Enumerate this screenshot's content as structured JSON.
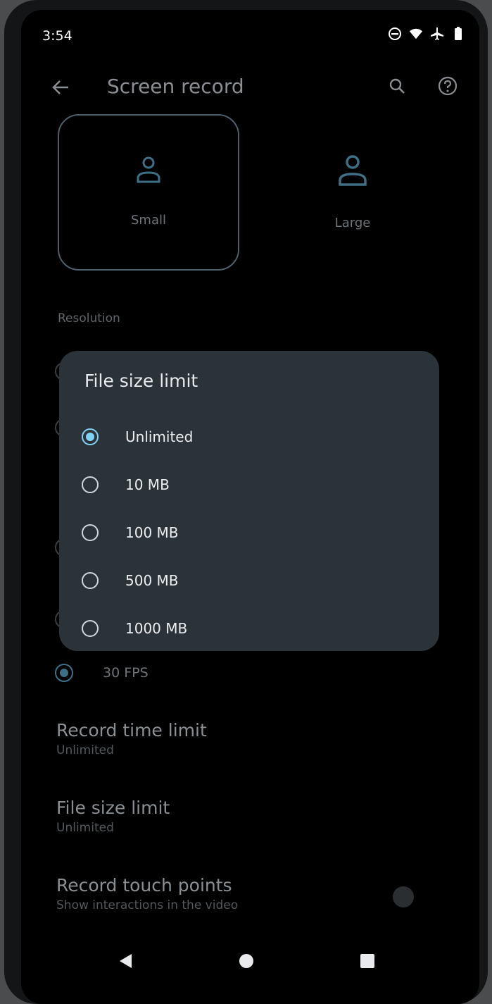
{
  "status_bar": {
    "time": "3:54",
    "icons": [
      "do-not-disturb-icon",
      "wifi-icon",
      "airplane-icon",
      "battery-icon"
    ]
  },
  "header": {
    "title": "Screen record",
    "back_icon": "arrow-left-icon",
    "search_icon": "search-icon",
    "help_icon": "help-icon"
  },
  "size_options": [
    {
      "label": "Small",
      "selected": true
    },
    {
      "label": "Large",
      "selected": false
    }
  ],
  "resolution_label": "Resolution",
  "dialog": {
    "title": "File size limit",
    "options": [
      {
        "label": "Unlimited",
        "checked": true
      },
      {
        "label": "10 MB",
        "checked": false
      },
      {
        "label": "100 MB",
        "checked": false
      },
      {
        "label": "500 MB",
        "checked": false
      },
      {
        "label": "1000 MB",
        "checked": false
      }
    ]
  },
  "fps": {
    "label": "30 FPS",
    "selected": true
  },
  "record_time_limit": {
    "title": "Record time limit",
    "value": "Unlimited"
  },
  "file_size_limit": {
    "title": "File size limit",
    "value": "Unlimited"
  },
  "record_touch_points": {
    "title": "Record touch points",
    "subtitle": "Show interactions in the video",
    "enabled": false
  },
  "nav_bar": {
    "back_icon": "triangle-back-icon",
    "home_icon": "circle-home-icon",
    "recents_icon": "square-recents-icon"
  },
  "colors": {
    "accent": "#7fd4f5",
    "dialog_bg": "#2c3338",
    "screen_bg": "#000000"
  }
}
